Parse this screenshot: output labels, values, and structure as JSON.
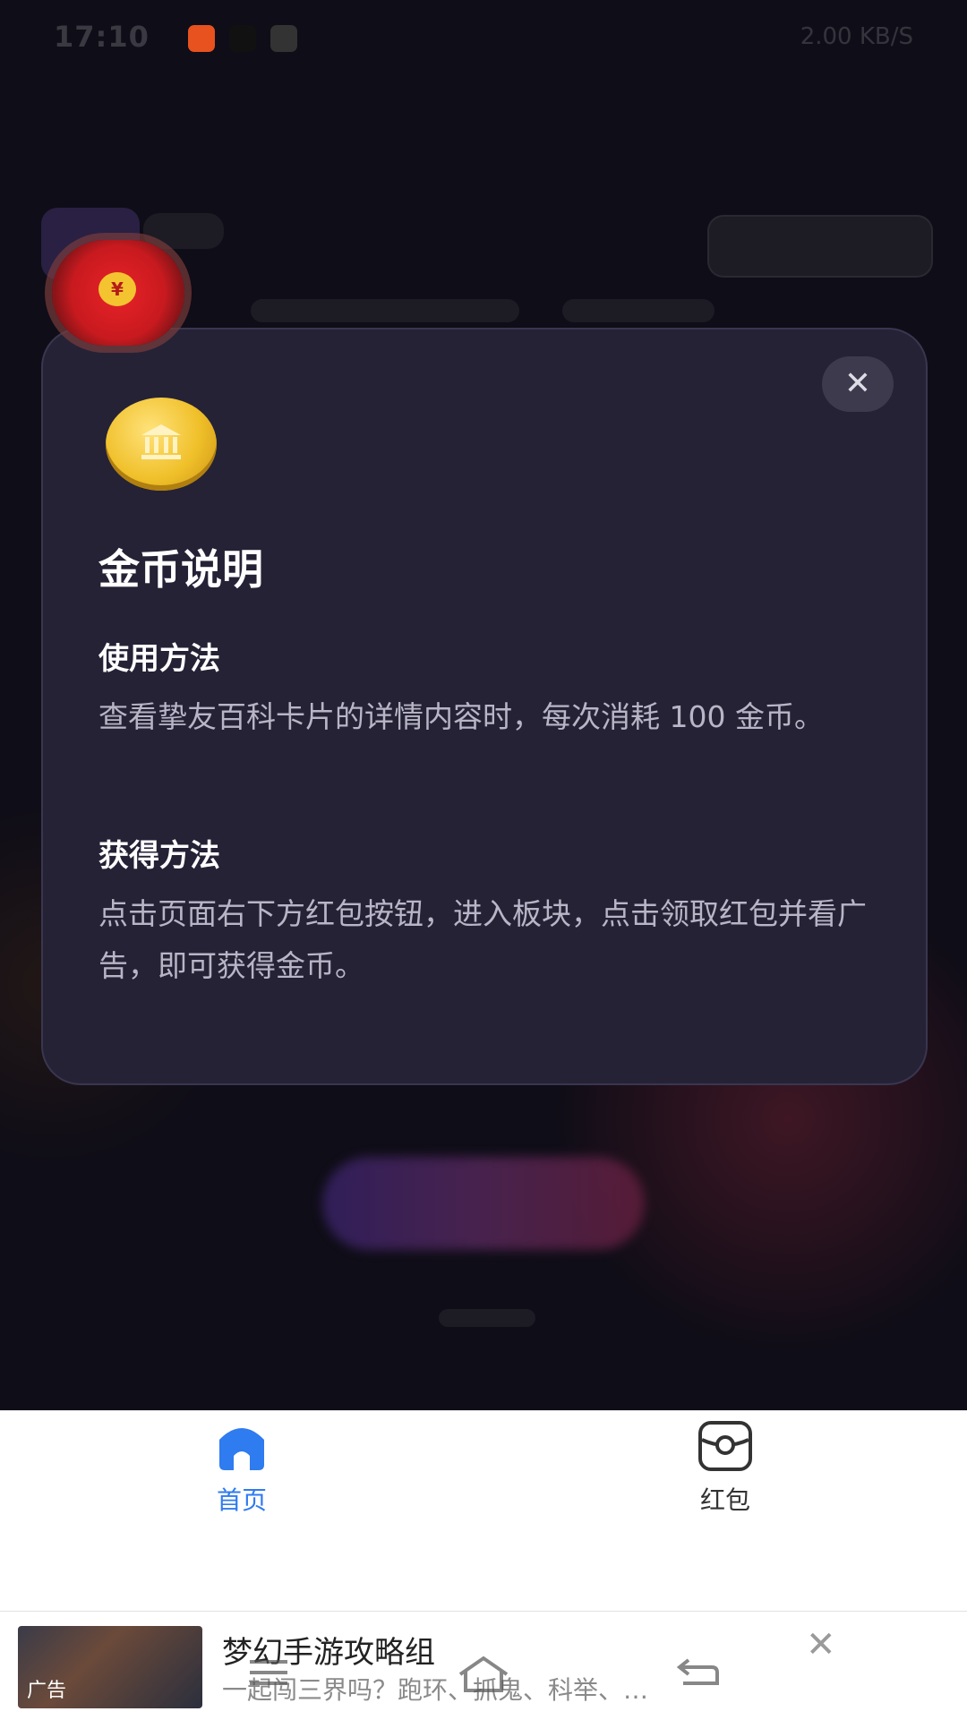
{
  "status_bar": {
    "time": "17:10",
    "right_text": "2.00 KB/S"
  },
  "modal": {
    "title": "金币说明",
    "close_symbol": "✕",
    "sections": [
      {
        "heading": "使用方法",
        "text": "查看挚友百科卡片的详情内容时，每次消耗 100 金币。"
      },
      {
        "heading": "获得方法",
        "text": "点击页面右下方红包按钮，进入板块，点击领取红包并看广告，即可获得金币。"
      }
    ]
  },
  "floating_red_packet": {
    "symbol": "¥"
  },
  "bottom_nav": {
    "items": [
      {
        "label": "首页",
        "icon": "home-icon",
        "active": true
      },
      {
        "label": "红包",
        "icon": "red-packet-icon",
        "active": false
      }
    ],
    "active_color": "#2f7bf0"
  },
  "ad": {
    "tag": "广告",
    "title": "梦幻手游攻略组",
    "description": "一起闯三界吗？跑环、抓鬼、科举、…",
    "close_symbol": "✕"
  }
}
